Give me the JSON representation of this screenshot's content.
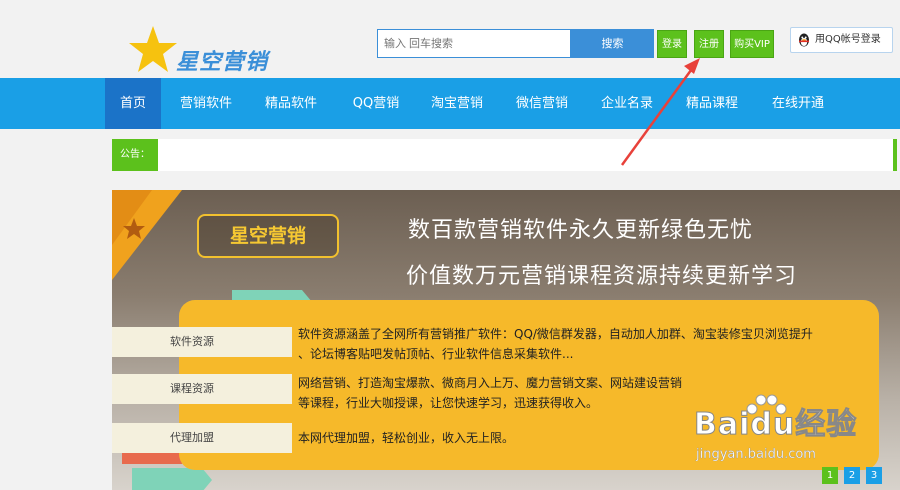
{
  "header": {
    "logo_text": "星空营销",
    "search": {
      "placeholder": "输入 回车搜索",
      "button": "搜索"
    },
    "buttons": {
      "login": "登录",
      "register": "注册",
      "vip": "购买VIP",
      "qq_login": "用QQ帐号登录"
    }
  },
  "nav": {
    "items": [
      {
        "label": "首页",
        "active": true
      },
      {
        "label": "营销软件"
      },
      {
        "label": "精品软件"
      },
      {
        "label": "QQ营销"
      },
      {
        "label": "淘宝营销"
      },
      {
        "label": "微信营销"
      },
      {
        "label": "企业名录"
      },
      {
        "label": "精品课程"
      },
      {
        "label": "在线开通"
      }
    ]
  },
  "notice": {
    "label": "公告："
  },
  "banner": {
    "brand": "星空营销",
    "slogan1": "数百款营销软件永久更新绿色无忧",
    "slogan2": "价值数万元营销课程资源持续更新学习",
    "tabs": [
      "软件资源",
      "课程资源",
      "代理加盟"
    ],
    "desc1_line1": "软件资源涵盖了全网所有营销推广软件：QQ/微信群发器，自动加人加群、淘宝装修宝贝浏览提升",
    "desc1_line2": "、论坛博客贴吧发帖顶帖、行业软件信息采集软件...",
    "desc2_line1": "网络营销、打造淘宝爆款、微商月入上万、魔力营销文案、网站建设营销",
    "desc2_line2": "等课程，行业大咖授课，让您快速学习，迅速获得收入。",
    "desc3": "本网代理加盟，轻松创业，收入无上限。",
    "pages": [
      "1",
      "2",
      "3"
    ]
  },
  "watermark": {
    "main": "Baidu经验",
    "sub": "jingyan.baidu.com"
  },
  "colors": {
    "nav": "#1a9fe6",
    "nav_active": "#1b73c8",
    "green": "#5cc11c",
    "panel": "#f6b92a",
    "annotation": "#e8413a"
  }
}
